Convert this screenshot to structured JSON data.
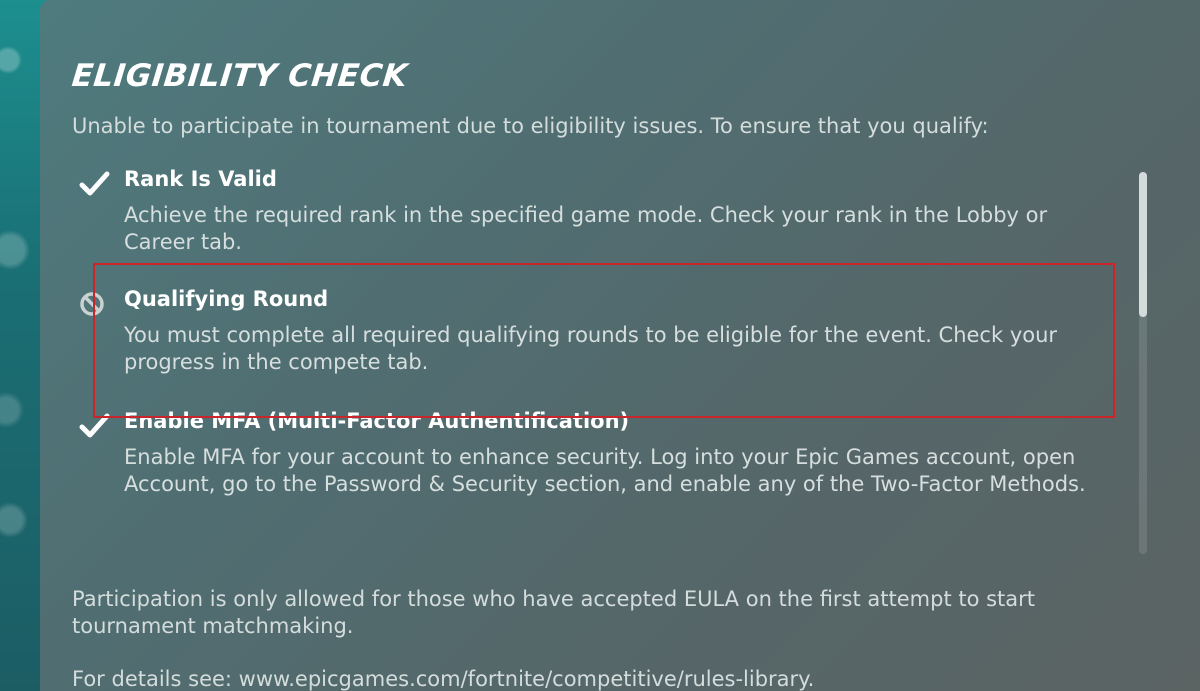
{
  "dialog": {
    "title": "ELIGIBILITY CHECK",
    "intro": "Unable to participate in tournament due to eligibility issues. To ensure that you qualify:"
  },
  "checks": [
    {
      "icon": "checkmark-icon",
      "status": "met",
      "title": "Rank Is Valid",
      "description": "Achieve the required rank in the specified game mode. Check your rank in the Lobby or Career tab."
    },
    {
      "icon": "blocked-icon",
      "status": "not-met",
      "title": "Qualifying Round",
      "description": "You must complete all required qualifying rounds to be eligible for the event. Check your progress in the compete tab."
    },
    {
      "icon": "checkmark-icon",
      "status": "met",
      "title": "Enable MFA (Multi-Factor Authentification)",
      "description": "Enable MFA for your account to enhance security. Log into your Epic Games account, open Account, go to the Password & Security section, and enable any of the Two-Factor Methods."
    }
  ],
  "footer": {
    "participation_note": "Participation is only allowed for those who have accepted EULA on the first attempt to start tournament matchmaking.",
    "details_link": "For details see: www.epicgames.com/fortnite/competitive/rules-library."
  },
  "colors": {
    "highlight_border": "#c8262b",
    "panel": "#506e72",
    "text_primary": "#ffffff",
    "text_secondary": "#d4dcdc"
  }
}
